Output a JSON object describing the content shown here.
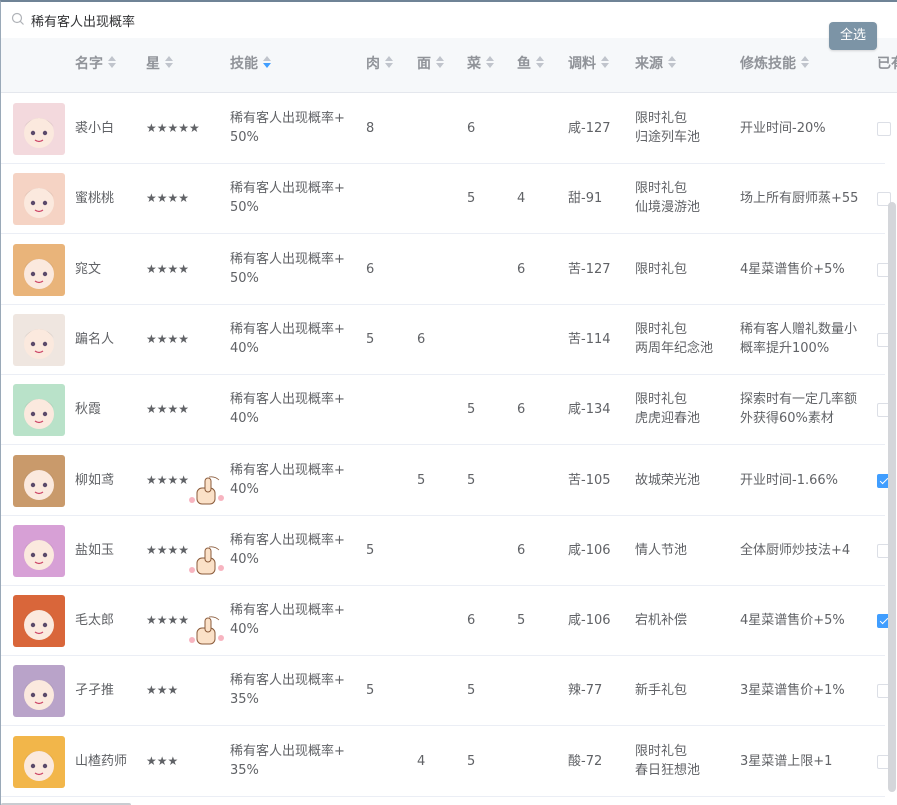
{
  "search": {
    "value": "稀有客人出现概率"
  },
  "select_all_label": "全选",
  "columns": {
    "name": "名字",
    "star": "星",
    "skill": "技能",
    "meat": "肉",
    "flour": "面",
    "veg": "菜",
    "fish": "鱼",
    "seasoning": "调料",
    "source": "来源",
    "ult": "修炼技能",
    "owned": "已有"
  },
  "rows": [
    {
      "name": "裘小白",
      "stars": "★★★★★",
      "skill1": "稀有客人出现概率+",
      "skill2": "50%",
      "meat": "8",
      "flour": "",
      "veg": "6",
      "fish": "",
      "seasoning": "咸-127",
      "source1": "限时礼包",
      "source2": "归途列车池",
      "ult1": "开业时间-20%",
      "ult2": "",
      "checked": false,
      "sticker": false,
      "avatar_color": "#f3d9dd"
    },
    {
      "name": "蜜桃桃",
      "stars": "★★★★",
      "skill1": "稀有客人出现概率+",
      "skill2": "50%",
      "meat": "",
      "flour": "",
      "veg": "5",
      "fish": "4",
      "seasoning": "甜-91",
      "source1": "限时礼包",
      "source2": "仙境漫游池",
      "ult1": "场上所有厨师蒸+55",
      "ult2": "",
      "checked": false,
      "sticker": false,
      "avatar_color": "#f5d3c4"
    },
    {
      "name": "窕文",
      "stars": "★★★★",
      "skill1": "稀有客人出现概率+",
      "skill2": "50%",
      "meat": "6",
      "flour": "",
      "veg": "",
      "fish": "6",
      "seasoning": "苦-127",
      "source1": "限时礼包",
      "source2": "",
      "ult1": "4星菜谱售价+5%",
      "ult2": "",
      "checked": false,
      "sticker": false,
      "avatar_color": "#e9b47a"
    },
    {
      "name": "蹁名人",
      "stars": "★★★★",
      "skill1": "稀有客人出现概率+",
      "skill2": "40%",
      "meat": "5",
      "flour": "6",
      "veg": "",
      "fish": "",
      "seasoning": "苦-114",
      "source1": "限时礼包",
      "source2": "两周年纪念池",
      "ult1": "稀有客人赠礼数量小",
      "ult2": "概率提升100%",
      "checked": false,
      "sticker": false,
      "avatar_color": "#efe6e0"
    },
    {
      "name": "秋霞",
      "stars": "★★★★",
      "skill1": "稀有客人出现概率+",
      "skill2": "40%",
      "meat": "",
      "flour": "",
      "veg": "5",
      "fish": "6",
      "seasoning": "咸-134",
      "source1": "限时礼包",
      "source2": "虎虎迎春池",
      "ult1": "探索时有一定几率额",
      "ult2": "外获得60%素材",
      "checked": false,
      "sticker": false,
      "avatar_color": "#b9e2c9"
    },
    {
      "name": "柳如鸢",
      "stars": "★★★★",
      "skill1": "稀有客人出现概率+",
      "skill2": "40%",
      "meat": "",
      "flour": "5",
      "veg": "5",
      "fish": "",
      "seasoning": "苦-105",
      "source1": "故城荣光池",
      "source2": "",
      "ult1": "开业时间-1.66%",
      "ult2": "",
      "checked": true,
      "sticker": true,
      "avatar_color": "#c99a6b"
    },
    {
      "name": "盐如玉",
      "stars": "★★★★",
      "skill1": "稀有客人出现概率+",
      "skill2": "40%",
      "meat": "5",
      "flour": "",
      "veg": "",
      "fish": "6",
      "seasoning": "咸-106",
      "source1": "情人节池",
      "source2": "",
      "ult1": "全体厨师炒技法+4",
      "ult2": "",
      "checked": false,
      "sticker": true,
      "avatar_color": "#d7a0d6"
    },
    {
      "name": "毛太郎",
      "stars": "★★★★",
      "skill1": "稀有客人出现概率+",
      "skill2": "40%",
      "meat": "",
      "flour": "",
      "veg": "6",
      "fish": "5",
      "seasoning": "咸-106",
      "source1": "宕机补偿",
      "source2": "",
      "ult1": "4星菜谱售价+5%",
      "ult2": "",
      "checked": true,
      "sticker": true,
      "avatar_color": "#d9663a"
    },
    {
      "name": "孑孑推",
      "stars": "★★★",
      "skill1": "稀有客人出现概率+",
      "skill2": "35%",
      "meat": "5",
      "flour": "",
      "veg": "5",
      "fish": "",
      "seasoning": "辣-77",
      "source1": "新手礼包",
      "source2": "",
      "ult1": "3星菜谱售价+1%",
      "ult2": "",
      "checked": false,
      "sticker": false,
      "avatar_color": "#b9a3c9"
    },
    {
      "name": "山楂药师",
      "stars": "★★★",
      "skill1": "稀有客人出现概率+",
      "skill2": "35%",
      "meat": "",
      "flour": "4",
      "veg": "5",
      "fish": "",
      "seasoning": "酸-72",
      "source1": "限时礼包",
      "source2": "春日狂想池",
      "ult1": "3星菜谱上限+1",
      "ult2": "",
      "checked": false,
      "sticker": false,
      "avatar_color": "#f2b64a"
    }
  ]
}
